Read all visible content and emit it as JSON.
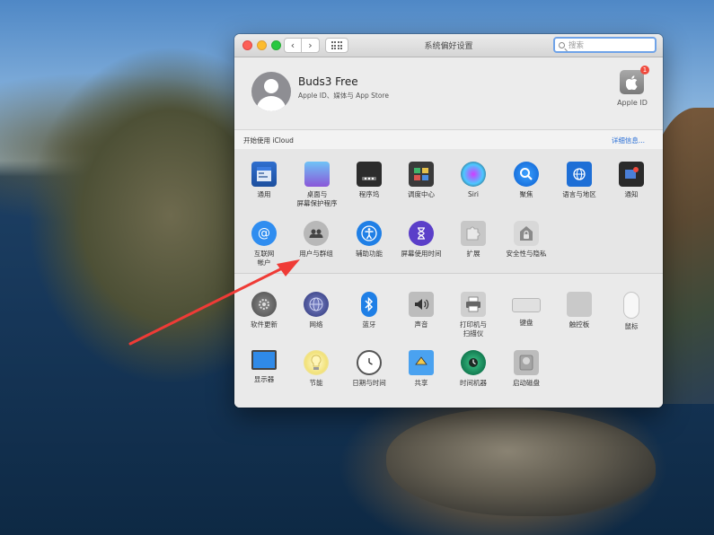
{
  "window": {
    "title": "系统偏好设置",
    "search_placeholder": "搜索"
  },
  "toolbar": {
    "back_symbol": "‹",
    "forward_symbol": "›"
  },
  "account": {
    "name": "Buds3 Free",
    "subtitle": "Apple ID、媒体与 App Store",
    "apple_id_label": "Apple ID",
    "apple_id_badge": "1"
  },
  "icloud": {
    "text": "开始使用 iCloud",
    "link": "详细信息..."
  },
  "section1": {
    "row1": [
      {
        "label": "通用",
        "icon": "general-icon"
      },
      {
        "label": "桌面与\n屏幕保护程序",
        "icon": "desktop-screensaver-icon"
      },
      {
        "label": "程序坞",
        "icon": "dock-icon"
      },
      {
        "label": "调度中心",
        "icon": "mission-control-icon"
      },
      {
        "label": "Siri",
        "icon": "siri-icon"
      },
      {
        "label": "聚焦",
        "icon": "spotlight-icon"
      },
      {
        "label": "语言与地区",
        "icon": "language-region-icon"
      },
      {
        "label": "通知",
        "icon": "notifications-icon"
      }
    ],
    "row2": [
      {
        "label": "互联网\n帐户",
        "icon": "internet-accounts-icon"
      },
      {
        "label": "用户与群组",
        "icon": "users-groups-icon"
      },
      {
        "label": "辅助功能",
        "icon": "accessibility-icon"
      },
      {
        "label": "屏幕使用时间",
        "icon": "screen-time-icon"
      },
      {
        "label": "扩展",
        "icon": "extensions-icon"
      },
      {
        "label": "安全性与隐私",
        "icon": "security-privacy-icon"
      }
    ]
  },
  "section2": {
    "row1": [
      {
        "label": "软件更新",
        "icon": "software-update-icon"
      },
      {
        "label": "网络",
        "icon": "network-icon"
      },
      {
        "label": "蓝牙",
        "icon": "bluetooth-icon"
      },
      {
        "label": "声音",
        "icon": "sound-icon"
      },
      {
        "label": "打印机与\n扫描仪",
        "icon": "printers-scanners-icon"
      },
      {
        "label": "键盘",
        "icon": "keyboard-icon"
      },
      {
        "label": "触控板",
        "icon": "trackpad-icon"
      },
      {
        "label": "鼠标",
        "icon": "mouse-icon"
      }
    ],
    "row2": [
      {
        "label": "显示器",
        "icon": "displays-icon"
      },
      {
        "label": "节能",
        "icon": "energy-saver-icon"
      },
      {
        "label": "日期与时间",
        "icon": "date-time-icon"
      },
      {
        "label": "共享",
        "icon": "sharing-icon"
      },
      {
        "label": "时间机器",
        "icon": "time-machine-icon"
      },
      {
        "label": "启动磁盘",
        "icon": "startup-disk-icon"
      }
    ]
  },
  "annotation": {
    "arrow_color": "#ef3b36"
  }
}
